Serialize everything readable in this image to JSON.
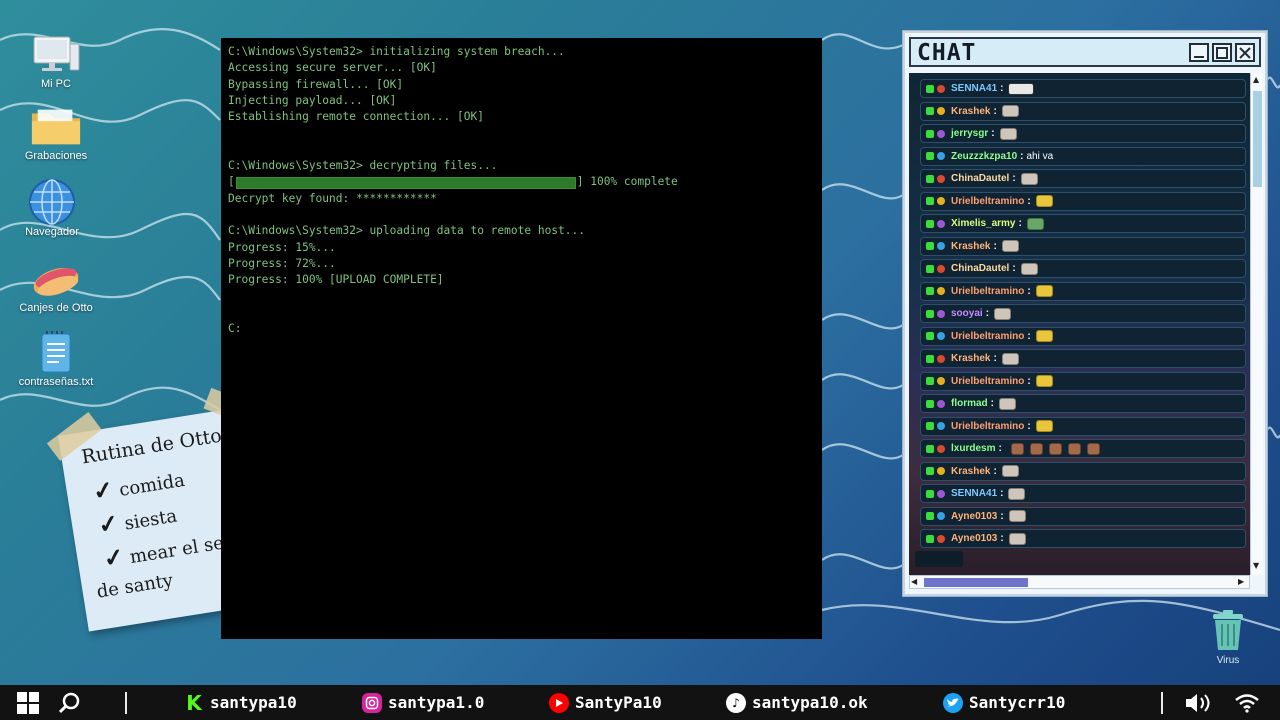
{
  "desktop_icons": [
    {
      "label": "Mi PC",
      "icon": "computer-icon"
    },
    {
      "label": "Grabaciones",
      "icon": "folder-icon"
    },
    {
      "label": "Navegador",
      "icon": "globe-icon"
    },
    {
      "label": "Canjes de Otto",
      "icon": "hotdog-icon"
    },
    {
      "label": "contraseñas.txt",
      "icon": "text-file-icon"
    }
  ],
  "terminal": {
    "lines": [
      "C:\\Windows\\System32> initializing system breach...",
      "Accessing secure server... [OK]",
      "Bypassing firewall... [OK]",
      "Injecting payload... [OK]",
      "Establishing remote connection... [OK]",
      "",
      "",
      "C:\\Windows\\System32> decrypting files...",
      "Decrypt key found: ************",
      "",
      "C:\\Windows\\System32> uploading data to remote host...",
      "Progress: 15%...",
      "Progress: 72%...",
      "Progress: 100% [UPLOAD COMPLETE]",
      "",
      "",
      "C:"
    ],
    "progress_prefix": "[",
    "progress_suffix": "] 100% complete",
    "progress_value": 1.0
  },
  "sticky_note": {
    "title": "Rutina de Otto",
    "items": [
      "comida",
      "siesta",
      "mear el se",
      "de santy"
    ],
    "check_glyph": "✓"
  },
  "chat": {
    "title": "CHAT",
    "messages": [
      {
        "user": "SENNA41",
        "color": "#7fc8ff",
        "text": "",
        "emotes": [
          "dark"
        ]
      },
      {
        "user": "Krashek",
        "color": "#ffb37a",
        "text": "",
        "emotes": [
          "plain"
        ]
      },
      {
        "user": "jerrysgr",
        "color": "#8dff8d",
        "text": "",
        "emotes": [
          "plain"
        ]
      },
      {
        "user": "Zeuzzzkzpa10",
        "color": "#8dff8d",
        "text": "ahi va",
        "emotes": []
      },
      {
        "user": "ChinaDautel",
        "color": "#ffd9a0",
        "text": "",
        "emotes": [
          "plain"
        ]
      },
      {
        "user": "Urielbeltramino",
        "color": "#ff9f70",
        "text": "",
        "emotes": [
          "yellow"
        ]
      },
      {
        "user": "Ximelis_army",
        "color": "#d8ff7a",
        "text": "",
        "emotes": [
          "green"
        ]
      },
      {
        "user": "Krashek",
        "color": "#ffb37a",
        "text": "",
        "emotes": [
          "plain"
        ]
      },
      {
        "user": "ChinaDautel",
        "color": "#ffd9a0",
        "text": "",
        "emotes": [
          "plain"
        ]
      },
      {
        "user": "Urielbeltramino",
        "color": "#ff9f70",
        "text": "",
        "emotes": [
          "yellow"
        ]
      },
      {
        "user": "sooyai",
        "color": "#c98bff",
        "text": "",
        "emotes": [
          "plain"
        ]
      },
      {
        "user": "Urielbeltramino",
        "color": "#ff9f70",
        "text": "",
        "emotes": [
          "yellow"
        ]
      },
      {
        "user": "Krashek",
        "color": "#ffb37a",
        "text": "",
        "emotes": [
          "plain"
        ]
      },
      {
        "user": "Urielbeltramino",
        "color": "#ff9f70",
        "text": "",
        "emotes": [
          "yellow"
        ]
      },
      {
        "user": "flormad",
        "color": "#8dff8d",
        "text": "",
        "emotes": [
          "plain"
        ]
      },
      {
        "user": "Urielbeltramino",
        "color": "#ff9f70",
        "text": "",
        "emotes": [
          "yellow"
        ]
      },
      {
        "user": "lxurdesm",
        "color": "#8dff8d",
        "text": "",
        "emotes": [
          "brown",
          "brown",
          "brown",
          "brown",
          "brown"
        ]
      },
      {
        "user": "Krashek",
        "color": "#ffb37a",
        "text": "",
        "emotes": [
          "plain"
        ]
      },
      {
        "user": "SENNA41",
        "color": "#7fc8ff",
        "text": "",
        "emotes": [
          "plain"
        ]
      },
      {
        "user": "Ayne0103",
        "color": "#ffb37a",
        "text": "",
        "emotes": [
          "plain"
        ]
      },
      {
        "user": "Ayne0103",
        "color": "#ffb37a",
        "text": "",
        "emotes": [
          "plain"
        ]
      }
    ]
  },
  "recycle_bin": {
    "label": "Virus",
    "icon": "recycle-bin-icon"
  },
  "taskbar": {
    "start_icon": "windows-start-icon",
    "search_icon": "search-icon",
    "socials": [
      {
        "platform": "kick",
        "handle": "santypa10",
        "color": "#53fc18"
      },
      {
        "platform": "instagram",
        "handle": "santypa1.0",
        "color": "#d6249f"
      },
      {
        "platform": "youtube",
        "handle": "SantyPa10",
        "color": "#ff0000"
      },
      {
        "platform": "tiktok",
        "handle": "santypa10.ok",
        "color": "#000000"
      },
      {
        "platform": "twitter",
        "handle": "Santycrr10",
        "color": "#1da1f2"
      }
    ],
    "tray": [
      "volume-icon",
      "wifi-icon"
    ]
  }
}
